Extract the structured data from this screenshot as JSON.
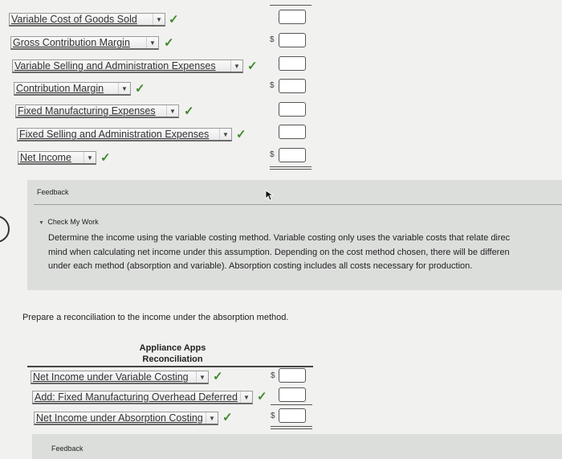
{
  "statement_rows": [
    {
      "label": "Variable Cost of Goods Sold",
      "status": "correct"
    },
    {
      "label": "Gross Contribution Margin",
      "status": "correct"
    },
    {
      "label": "Variable Selling and Administration Expenses",
      "status": "correct"
    },
    {
      "label": "Contribution Margin",
      "status": "correct"
    },
    {
      "label": "Fixed Manufacturing Expenses",
      "status": "correct"
    },
    {
      "label": "Fixed Selling and Administration Expenses",
      "status": "correct"
    },
    {
      "label": "Net Income",
      "status": "correct"
    }
  ],
  "symbols": {
    "check": "✓",
    "dollar": "$",
    "dropdown": "▼",
    "collapse": "▼"
  },
  "feedback": {
    "label": "Feedback",
    "check_my_work": "Check My Work",
    "lines": [
      "Determine the income using the variable costing method. Variable costing only uses the variable costs that relate direc",
      "mind when calculating net income under this assumption. Depending on the cost method chosen, there will be differen",
      "under each method (absorption and variable). Absorption costing includes all costs necessary for production."
    ]
  },
  "prompt": "Prepare a reconciliation to the income under the absorption method.",
  "reconciliation": {
    "company": "Appliance Apps",
    "title": "Reconciliation",
    "rows": [
      {
        "label": "Net Income under Variable Costing",
        "status": "correct"
      },
      {
        "label": "Add: Fixed Manufacturing Overhead Deferred",
        "status": "correct"
      },
      {
        "label": "Net Income under Absorption Costing",
        "status": "correct"
      }
    ]
  },
  "feedback2": {
    "label": "Feedback"
  }
}
